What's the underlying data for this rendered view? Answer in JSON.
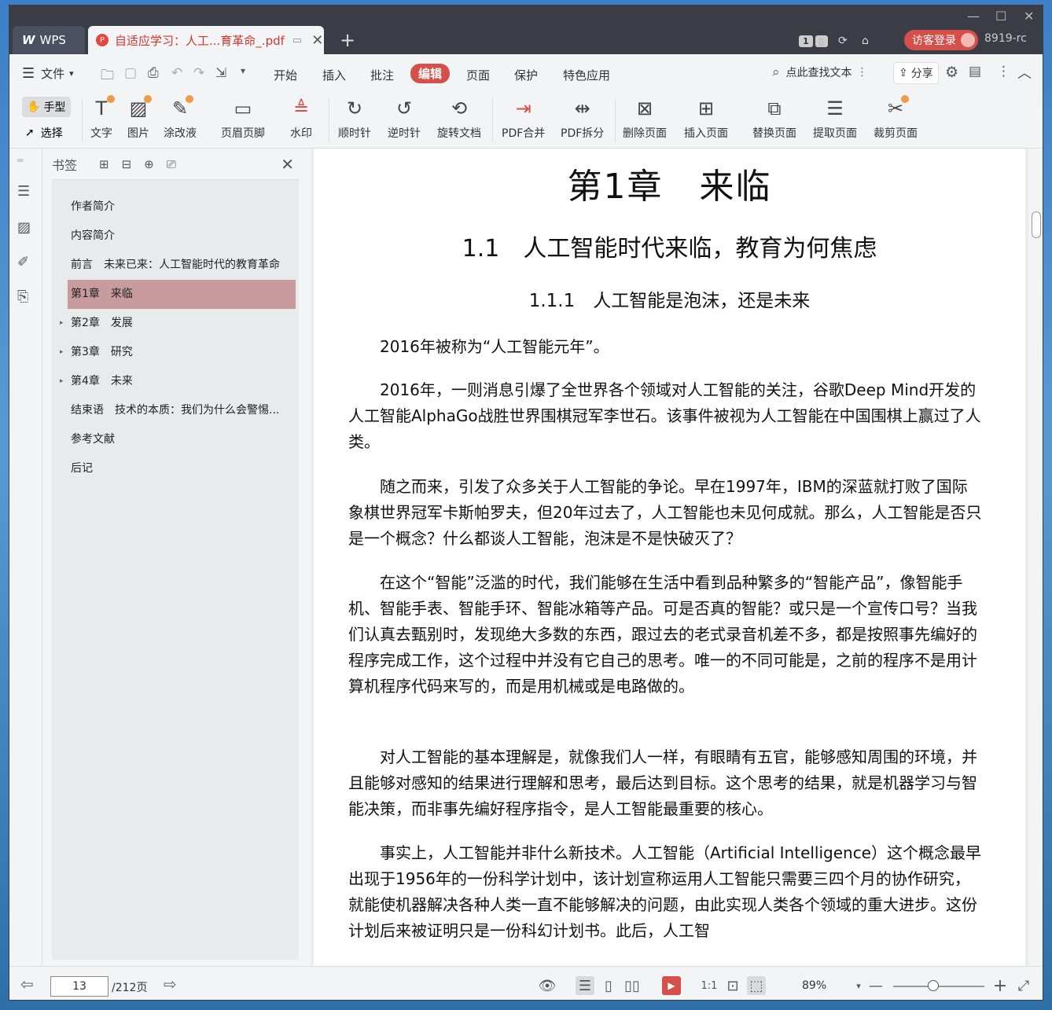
{
  "titlebar": {
    "app_tab": "WPS",
    "doc_tab": "自适应学习：人工...育革命_.pdf",
    "page_badge": "1",
    "login_label": "访客登录",
    "version": "8919-rc"
  },
  "menubar": {
    "file_label": "文件",
    "tabs": [
      "开始",
      "插入",
      "批注",
      "编辑",
      "页面",
      "保护",
      "特色应用"
    ],
    "active_tab": "编辑",
    "search_label": "点此查找文本",
    "share_label": "分享"
  },
  "ribbon": {
    "hand_label": "手型",
    "select_label": "选择",
    "buttons": [
      "文字",
      "图片",
      "涂改液",
      "页眉页脚",
      "水印",
      "顺时针",
      "逆时针",
      "旋转文档",
      "PDF合并",
      "PDF拆分",
      "删除页面",
      "插入页面",
      "替换页面",
      "提取页面",
      "裁剪页面"
    ]
  },
  "bookmarks": {
    "title": "书签",
    "items": [
      "作者简介",
      "内容简介",
      "前言　未来已来：人工智能时代的教育革命",
      "第1章　来临",
      "第2章　发展",
      "第3章　研究",
      "第4章　未来",
      "结束语　技术的本质：我们为什么会警惕...",
      "参考文献",
      "后记"
    ],
    "active_index": 3
  },
  "document": {
    "chapter_title": "第1章　来临",
    "section_title": "1.1　人工智能时代来临，教育为何焦虑",
    "subsection_title": "1.1.1　人工智能是泡沫，还是未来",
    "paragraphs": [
      "2016年被称为“人工智能元年”。",
      "2016年，一则消息引爆了全世界各个领域对人工智能的关注，谷歌Deep Mind开发的人工智能AlphaGo战胜世界围棋冠军李世石。该事件被视为人工智能在中国围棋上赢过了人类。",
      "随之而来，引发了众多关于人工智能的争论。早在1997年，IBM的深蓝就打败了国际象棋世界冠军卡斯帕罗夫，但20年过去了，人工智能也未见何成就。那么，人工智能是否只是一个概念？什么都谈人工智能，泡沫是不是快破灭了？",
      "在这个“智能”泛滥的时代，我们能够在生活中看到品种繁多的“智能产品”，像智能手机、智能手表、智能手环、智能冰箱等产品。可是否真的智能？或只是一个宣传口号？当我们认真去甄别时，发现绝大多数的东西，跟过去的老式录音机差不多，都是按照事先编好的程序完成工作，这个过程中并没有它自己的思考。唯一的不同可能是，之前的程序不是用计算机程序代码来写的，而是用机械或是电路做的。",
      "对人工智能的基本理解是，就像我们人一样，有眼睛有五官，能够感知周围的环境，并且能够对感知的结果进行理解和思考，最后达到目标。这个思考的结果，就是机器学习与智能决策，而非事先编好程序指令，是人工智能最重要的核心。",
      "事实上，人工智能并非什么新技术。人工智能（Artificial Intelligence）这个概念最早出现于1956年的一份科学计划中，该计划宣称运用人工智能只需要三四个月的协作研究，就能使机器解决各种人类一直不能够解决的问题，由此实现人类各个领域的重大进步。这份计划后来被证明只是一份科幻计划书。此后，人工智"
    ]
  },
  "statusbar": {
    "current_page": "13",
    "total_pages": "/212页",
    "zoom": "89%"
  },
  "colors": {
    "accent": "#d5504a",
    "titlebar": "#3a3d45",
    "bookmark_active": "#c89b9f"
  }
}
